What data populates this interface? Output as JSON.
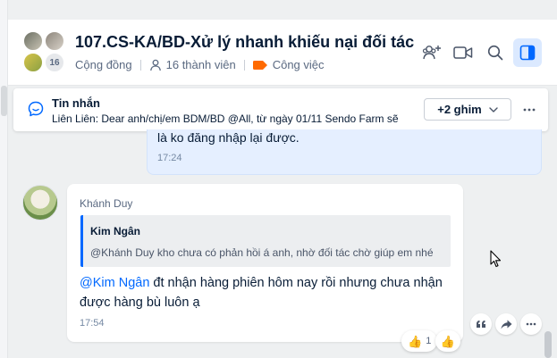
{
  "header": {
    "title": "107.CS-KA/BD-Xử lý nhanh khiếu nại đối tác",
    "member_count_badge": "16",
    "community_label": "Cộng đồng",
    "members_label": "16 thành viên",
    "category_label": "Công việc",
    "category_color": "#ff6a00",
    "icons": [
      "add-member-icon",
      "video-call-icon",
      "search-icon",
      "sidebar-toggle-icon"
    ]
  },
  "pinned": {
    "title": "Tin nhắn",
    "preview": "Liên Liên: Dear anh/chị/em BDM/BD @All, từ ngày 01/11 Sendo Farm sẽ",
    "pin_button": "+2 ghim"
  },
  "own_message": {
    "text": "là ko đăng nhập lại được.",
    "time": "17:24"
  },
  "incoming_message": {
    "sender": "Khánh Duy",
    "quote_name": "Kim Ngân",
    "quote_text": "@Khánh Duy kho chưa có phản hồi á anh, nhờ đối tác chờ giúp em nhé",
    "mention": "@Kim Ngân",
    "body": " đt nhận hàng phiên hôm nay rồi nhưng chưa nhận được hàng bù luôn ạ",
    "time": "17:54"
  },
  "reactions": {
    "thumbs_count": "1"
  },
  "colors": {
    "accent": "#0068ff",
    "own_bubble": "#e5efff",
    "background": "#eef0f1"
  }
}
